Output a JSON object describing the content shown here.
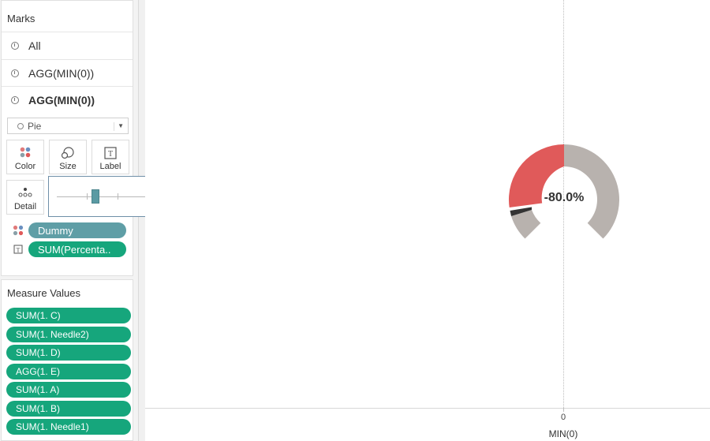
{
  "marks": {
    "title": "Marks",
    "rows": [
      {
        "label": "All"
      },
      {
        "label": "AGG(MIN(0))"
      },
      {
        "label": "AGG(MIN(0))"
      }
    ],
    "mark_type": "Pie",
    "buttons": {
      "color": "Color",
      "size": "Size",
      "label": "Label",
      "detail": "Detail"
    },
    "pills": {
      "color_pill": "Dummy",
      "label_pill": "SUM(Percenta.."
    }
  },
  "size_slider": {
    "value_fraction": 0.32
  },
  "measure_values": {
    "title": "Measure Values",
    "items": [
      "SUM(1. C)",
      "SUM(1. Needle2)",
      "SUM(1. D)",
      "AGG(1. E)",
      "SUM(1. A)",
      "SUM(1. B)",
      "SUM(1. Needle1)"
    ]
  },
  "view": {
    "axis_tick": "0",
    "axis_title": "MIN(0)",
    "gauge_label": "-80.0%"
  },
  "colors": {
    "gauge_red": "#e05a5a",
    "gauge_gray": "#b8b2ae",
    "needle": "#333333",
    "pill_green": "#16a67c",
    "pill_blue": "#5f9ea6"
  }
}
